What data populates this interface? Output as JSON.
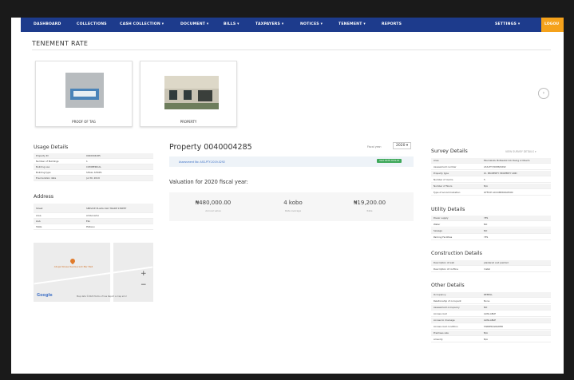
{
  "nav": {
    "items": [
      "DASHBOARD",
      "COLLECTIONS",
      "CASH COLLECTION ▾",
      "DOCUMENT ▾",
      "BILLS ▾",
      "TAXPAYERS ▾",
      "NOTICES ▾",
      "TENEMENT ▾",
      "REPORTS"
    ],
    "settings": "SETTINGS ▾",
    "right": "LOGOU"
  },
  "page": {
    "title": "TENEMENT RATE"
  },
  "gallery": {
    "card1_label": "PROOF OF TAG",
    "card2_label": "PROPERTY"
  },
  "usage": {
    "title": "Usage Details",
    "rows": [
      {
        "k": "Property ID",
        "v": "0040004285"
      },
      {
        "k": "Number of Buildings",
        "v": "1"
      },
      {
        "k": "Building use",
        "v": "COMMERCIAL"
      },
      {
        "k": "Building type",
        "v": "SHALL SHOPS"
      },
      {
        "k": "Enumeration date",
        "v": "Jul 30, 2019"
      }
    ]
  },
  "address": {
    "title": "Address",
    "rows": [
      {
        "k": "Street",
        "v": "SERVICE PLAZA OLD TRADE STREET"
      },
      {
        "k": "Area",
        "v": "Ambonamo"
      },
      {
        "k": "LGA",
        "v": "Eko"
      },
      {
        "k": "State",
        "v": "Plateau"
      }
    ],
    "map_pin_label": "Abuja Nosse Restaurant Bar Bell",
    "google": "Google",
    "map_footer": "Map data ©2020   Terms of Use   Report a map error"
  },
  "property": {
    "title": "Property 0040004285",
    "fiscal_label": "Fiscal year:",
    "fiscal_year": "2020 ▾",
    "assessment_link": "Assessment No: ASS-PTY-2019-0292",
    "badge": "Valid RATE 2019-20",
    "valuation_title": "Valuation for 2020 fiscal year:",
    "stats": [
      {
        "num": "₦480,000.00",
        "cap": "Annual value"
      },
      {
        "num": "4 kobo",
        "cap": "Rate average"
      },
      {
        "num": "₦19,200.00",
        "cap": "Rate"
      }
    ]
  },
  "survey": {
    "title": "Survey Details",
    "link": "VIEW SURVEY DETAILS ▾",
    "rows": [
      {
        "k": "Area",
        "v": "Ekumaloku Bofawolik Inb Daing ol Obeim"
      },
      {
        "k": "Assessment number",
        "v": "ASS-PTY/0088/0292"
      },
      {
        "k": "Property type",
        "v": "Ol. PROPERTY PROPERTY AND"
      },
      {
        "k": "Number of rooms",
        "v": "5"
      },
      {
        "k": "Number of floors",
        "v": "N/A"
      },
      {
        "k": "Type of accommodation",
        "v": "OFFICE ACCOMMODATION"
      }
    ]
  },
  "utility": {
    "title": "Utility Details",
    "rows": [
      {
        "k": "Power supply",
        "v": "YES"
      },
      {
        "k": "Water",
        "v": "NO"
      },
      {
        "k": "Sewage",
        "v": "NO"
      },
      {
        "k": "Parking Facilities",
        "v": "YES"
      }
    ]
  },
  "construction": {
    "title": "Construction Details",
    "rows": [
      {
        "k": "Description of wall",
        "v": "plastered and painted"
      },
      {
        "k": "Description of roofline",
        "v": "metal"
      }
    ]
  },
  "other": {
    "title": "Other Details",
    "rows": [
      {
        "k": "Occupancy",
        "v": "RENTAL"
      },
      {
        "k": "Relationship of occupant",
        "v": "None"
      },
      {
        "k": "Assessment occupancy",
        "v": "NO"
      },
      {
        "k": "Access road",
        "v": "AVAILABLE"
      },
      {
        "k": "Access to drainage",
        "v": "AVAILABLE"
      },
      {
        "k": "Access road condition",
        "v": "TARRED/GRADED"
      },
      {
        "k": "Premises size",
        "v": "N/A"
      },
      {
        "k": "Amenity",
        "v": "N/A"
      }
    ]
  }
}
